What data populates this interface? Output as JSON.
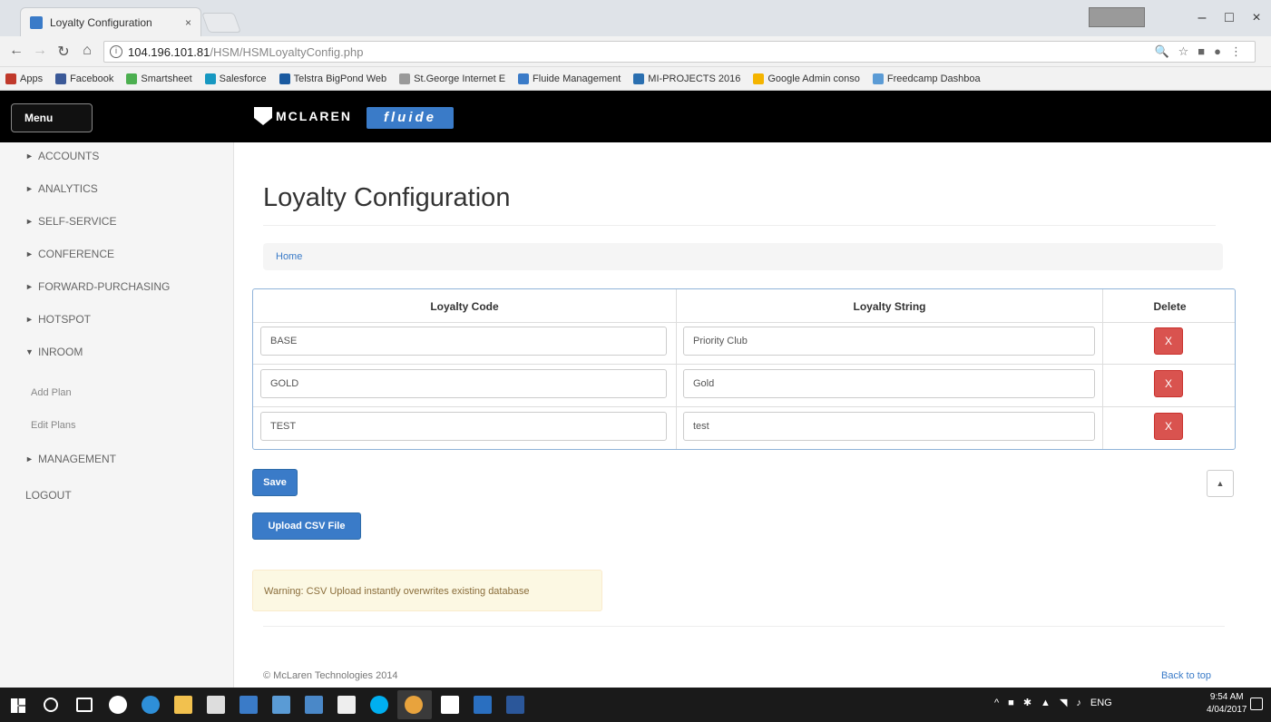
{
  "browser": {
    "tab_title": "Loyalty Configuration",
    "tab_close": "×",
    "win_minimize": "–",
    "win_maximize": "□",
    "win_close": "×",
    "url_host": "104.196.101.81",
    "url_path": "/HSM/HSMLoyaltyConfig.php",
    "bookmarks": [
      {
        "label": "Apps",
        "color": "#c0392b"
      },
      {
        "label": "Facebook",
        "color": "#3b5998"
      },
      {
        "label": "Smartsheet",
        "color": "#4caf50"
      },
      {
        "label": "Salesforce",
        "color": "#1798c1"
      },
      {
        "label": "Telstra BigPond Web",
        "color": "#1a5aa0"
      },
      {
        "label": "St.George Internet E",
        "color": "#999999"
      },
      {
        "label": "Fluide Management",
        "color": "#3a7bc8"
      },
      {
        "label": "MI-PROJECTS 2016",
        "color": "#2a6fb0"
      },
      {
        "label": "Google Admin conso",
        "color": "#f4b400"
      },
      {
        "label": "Freedcamp Dashboa",
        "color": "#5b9bd5"
      }
    ]
  },
  "header": {
    "menu_label": "Menu",
    "logo_text": "MCLAREN",
    "product_logo": "fluide"
  },
  "sidebar": {
    "items": [
      {
        "label": "ACCOUNTS",
        "arrow": "►"
      },
      {
        "label": "ANALYTICS",
        "arrow": "►"
      },
      {
        "label": "SELF-SERVICE",
        "arrow": "►"
      },
      {
        "label": "CONFERENCE",
        "arrow": "►"
      },
      {
        "label": "FORWARD-PURCHASING",
        "arrow": "►"
      },
      {
        "label": "HOTSPOT",
        "arrow": "►"
      },
      {
        "label": "INROOM",
        "arrow": "▼"
      }
    ],
    "sub_items": [
      "Add Plan",
      "Edit Plans"
    ],
    "management": {
      "label": "MANAGEMENT",
      "arrow": "►"
    },
    "logout": "LOGOUT"
  },
  "main": {
    "title": "Loyalty Configuration",
    "breadcrumb": "Home",
    "table": {
      "headers": [
        "Loyalty Code",
        "Loyalty String",
        "Delete"
      ],
      "rows": [
        {
          "code": "BASE",
          "string": "Priority Club",
          "delete": "X"
        },
        {
          "code": "GOLD",
          "string": "Gold",
          "delete": "X"
        },
        {
          "code": "TEST",
          "string": "test",
          "delete": "X"
        }
      ]
    },
    "save_label": "Save",
    "scroll_top_glyph": "▲",
    "upload_label": "Upload CSV File",
    "warning": "Warning: CSV Upload instantly overwrites existing database"
  },
  "footer": {
    "copyright": "© McLaren Technologies 2014",
    "back_to_top": "Back to top"
  },
  "taskbar": {
    "language": "ENG",
    "time": "9:54 AM",
    "date": "4/04/2017"
  }
}
